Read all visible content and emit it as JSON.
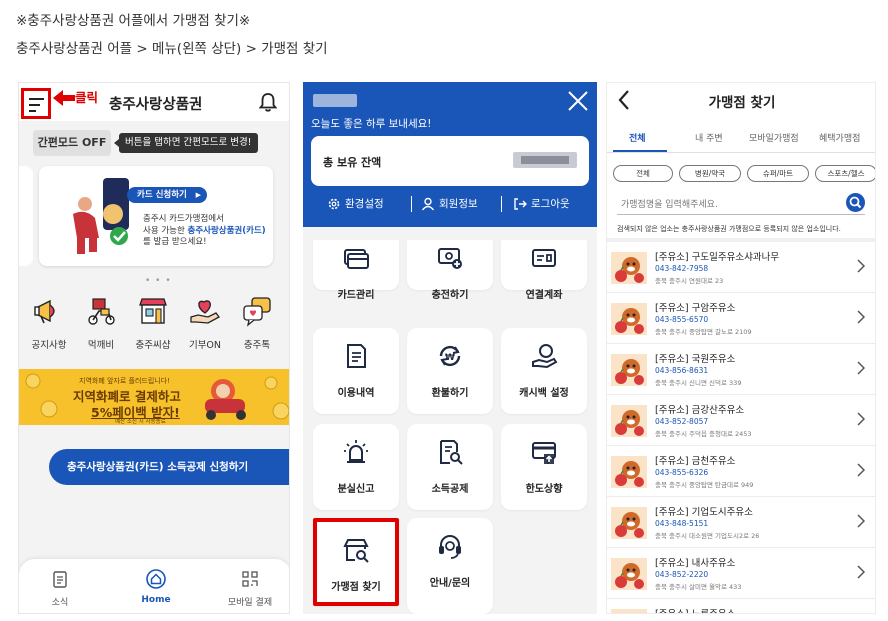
{
  "captions": {
    "line1": "※충주사랑상품권 어플에서 가맹점 찾기※",
    "line2": "충주사랑상품권 어플 > 메뉴(왼쪽 상단) > 가맹점 찾기"
  },
  "panel1": {
    "click_label": "클릭",
    "title": "충주사랑상품권",
    "simple_mode": "간편모드 OFF",
    "simple_tip": "버튼을 탭하면 간편모드로 변경!",
    "banner": {
      "pill": "카드 신청하기",
      "text1": "충주시 카드가맹점에서",
      "text2_a": "사용 가능한 ",
      "text2_b": "충주사랑상품권(카드)",
      "text3": "를 발급 받으세요!"
    },
    "dots": "• • •",
    "icons": [
      {
        "label": "공지사항",
        "icon": "megaphone-icon"
      },
      {
        "label": "먹깨비",
        "icon": "delivery-icon"
      },
      {
        "label": "충주씨샵",
        "icon": "shop-icon"
      },
      {
        "label": "기부ON",
        "icon": "donate-heart-icon"
      },
      {
        "label": "충주톡",
        "icon": "chat-icon"
      }
    ],
    "promo": {
      "line1": "지역화폐 앞자로 플러드립니다!",
      "line2": "지역화폐로 결제하고",
      "line3": "5%페이백 받자!",
      "line4": "예산 소진 시 자동종료"
    },
    "cta": "충주사랑상품권(카드) 소득공제 신청하기",
    "bottom_nav": [
      "소식",
      "Home",
      "모바일 결제"
    ]
  },
  "panel2": {
    "greeting": "오늘도 좋은 하루 보내세요!",
    "balance_label": "총 보유 잔액",
    "settings": [
      "환경설정",
      "회원정보",
      "로그아웃"
    ],
    "tiles": [
      {
        "label": "카드관리",
        "icon": "card-icon"
      },
      {
        "label": "충전하기",
        "icon": "charge-icon"
      },
      {
        "label": "연결계좌",
        "icon": "bank-account-icon"
      },
      {
        "label": "이용내역",
        "icon": "history-icon"
      },
      {
        "label": "환불하기",
        "icon": "refund-icon"
      },
      {
        "label": "캐시백 설정",
        "icon": "cashback-icon"
      },
      {
        "label": "분실신고",
        "icon": "alarm-icon"
      },
      {
        "label": "소득공제",
        "icon": "tax-doc-icon"
      },
      {
        "label": "한도상향",
        "icon": "limit-up-icon"
      },
      {
        "label": "가맹점 찾기",
        "icon": "store-search-icon"
      },
      {
        "label": "안내/문의",
        "icon": "headset-icon"
      }
    ]
  },
  "panel3": {
    "title": "가맹점 찾기",
    "tabs": [
      "전체",
      "내 주변",
      "모바일가맹점",
      "혜택가맹점"
    ],
    "chips": [
      "전체",
      "병원/약국",
      "슈퍼/마트",
      "스포츠/헬스"
    ],
    "search_placeholder": "가맹점명을 입력해주세요.",
    "notice": "검색되지 않은 업소는 충주사랑상품권 가맹점으로 등록되지 않은 업소입니다.",
    "stores": [
      {
        "name": "[주유소] 구도일주유소샤과나무",
        "phone": "043-842-7958",
        "addr": "충북 충주시 연원대로 23"
      },
      {
        "name": "[주유소] 구암주유소",
        "phone": "043-855-6570",
        "addr": "충북 충주시 중앙탑면 갈노로 2109"
      },
      {
        "name": "[주유소] 국원주유소",
        "phone": "043-856-8631",
        "addr": "충북 충주시 신니면 신덕로 339"
      },
      {
        "name": "[주유소] 금강산주유소",
        "phone": "043-852-8057",
        "addr": "충북 충주시 주덕읍 충청대로 2453"
      },
      {
        "name": "[주유소] 금천주유소",
        "phone": "043-855-6326",
        "addr": "충북 충주시 중앙탑면 탄금대로 949"
      },
      {
        "name": "[주유소] 기업도시주유소",
        "phone": "043-848-5151",
        "addr": "충북 충주시 대소원면 기업도시2로 26"
      },
      {
        "name": "[주유소] 내사주유소",
        "phone": "043-852-2220",
        "addr": "충북 충주시 살미면 월악로 433"
      },
      {
        "name": "[주유소] 노루주유소",
        "phone": "",
        "addr": ""
      }
    ]
  }
}
